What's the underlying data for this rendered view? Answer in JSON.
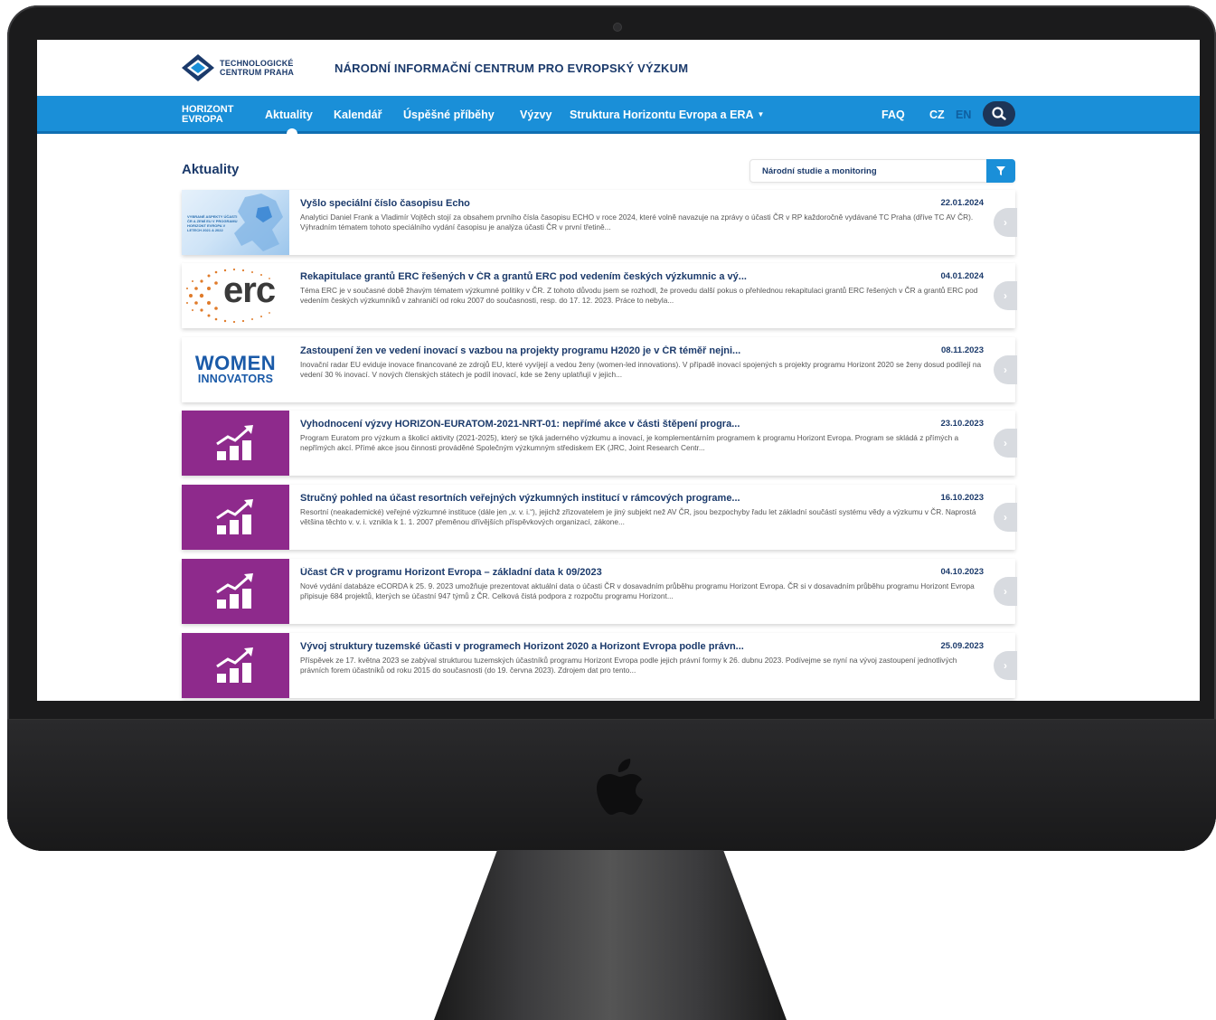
{
  "header": {
    "logo_line1": "TECHNOLOGICKÉ",
    "logo_line2": "CENTRUM PRAHA",
    "site_title": "NÁRODNÍ INFORMAČNÍ CENTRUM PRO EVROPSKÝ VÝZKUM"
  },
  "nav": {
    "brand_line1": "HORIZONT",
    "brand_line2": "EVROPA",
    "items": [
      "Aktuality",
      "Kalendář",
      "Úspěšné příběhy",
      "Výzvy",
      "Struktura Horizontu Evropa a ERA"
    ],
    "active": "Aktuality",
    "faq": "FAQ",
    "lang_cz": "CZ",
    "lang_en": "EN",
    "colors": {
      "bar": "#1a8fd8",
      "search_bg": "#1d3557"
    }
  },
  "page": {
    "heading": "Aktuality",
    "filter_value": "Národní studie a monitoring"
  },
  "news": [
    {
      "thumb": "map",
      "thumb_text": "VYBRANÉ ASPEKTY ÚČASTI ČR A ZEMÍ EU V PROGRAMU HORIZONT EVROPA V LETECH 2021 A 2022",
      "title": "Vyšlo speciální číslo časopisu Echo",
      "date": "22.01.2024",
      "text": "Analytici Daniel Frank a Vladimír Vojtěch stojí za obsahem prvního čísla časopisu ECHO v roce 2024, které volně navazuje na zprávy o účasti ČR v RP každoročně vydávané TC Praha (dříve TC AV ČR). Výhradním tématem tohoto speciálního vydání časopisu je analýza účasti ČR v první třetině..."
    },
    {
      "thumb": "erc",
      "thumb_text": "erc",
      "title": "Rekapitulace grantů ERC řešených v ČR a grantů ERC pod vedením českých výzkumnic a vý...",
      "date": "04.01.2024",
      "text": "Téma ERC je v současné době žhavým tématem výzkumné politiky v ČR. Z tohoto důvodu jsem se rozhodl, že provedu další pokus o přehlednou rekapitulaci grantů ERC řešených v ČR a grantů ERC pod vedením českých výzkumníků v zahraničí od roku 2007 do současnosti, resp. do 17. 12. 2023. Práce to nebyla..."
    },
    {
      "thumb": "women",
      "thumb_text_1": "WOMEN",
      "thumb_text_2": "INNOVATORS",
      "title": "Zastoupení žen ve vedení inovací s vazbou na projekty programu H2020 je v ČR téměř nejni...",
      "date": "08.11.2023",
      "text": "Inovační radar EU eviduje inovace financované ze zdrojů EU, které vyvíjejí a vedou ženy (women-led innovations). V případě inovací spojených s projekty programu Horizont 2020 se ženy dosud podílejí na vedení 30 % inovací. V nových členských státech je podíl inovací, kde se ženy uplatňují v jejich..."
    },
    {
      "thumb": "chart",
      "title": "Vyhodnocení výzvy HORIZON-EURATOM-2021-NRT-01: nepřímé akce v části štěpení progra...",
      "date": "23.10.2023",
      "text": "Program Euratom pro výzkum a školicí aktivity (2021-2025), který se týká jaderného výzkumu a inovací, je komplementárním programem k programu Horizont Evropa. Program se skládá z přímých a nepřímých akcí. Přímé akce jsou činnosti prováděné Společným výzkumným střediskem EK (JRC, Joint Research Centr..."
    },
    {
      "thumb": "chart",
      "title": "Stručný pohled na účast resortních veřejných výzkumných institucí v rámcových programe...",
      "date": "16.10.2023",
      "text": "Resortní (neakademické) veřejné výzkumné instituce (dále jen „v. v. i.“), jejichž zřizovatelem je jiný subjekt než AV ČR, jsou bezpochyby řadu let základní součástí systému vědy a výzkumu v ČR. Naprostá většina těchto v. v. i. vznikla k 1. 1. 2007 přeměnou dřívějších příspěvkových organizací, zákone..."
    },
    {
      "thumb": "chart",
      "title": "Účast ČR v programu Horizont Evropa – základní data k 09/2023",
      "date": "04.10.2023",
      "text": "Nové vydání databáze eCORDA k 25. 9. 2023 umožňuje prezentovat aktuální data o účasti ČR v dosavadním průběhu programu Horizont Evropa. ČR si v dosavadním průběhu programu Horizont Evropa připisuje 684 projektů, kterých se účastní 947 týmů z ČR. Celková čistá podpora z rozpočtu programu Horizont..."
    },
    {
      "thumb": "chart",
      "title": "Vývoj struktury tuzemské účasti v programech Horizont 2020 a Horizont Evropa podle právn...",
      "date": "25.09.2023",
      "text": "Příspěvek ze 17. května 2023 se zabýval strukturou tuzemských účastníků programu Horizont Evropa podle jejich právní formy k 26. dubnu 2023. Podívejme se nyní na vývoj zastoupení jednotlivých právních forem účastníků od roku 2015 do současnosti (do 19. června 2023). Zdrojem dat pro tento..."
    }
  ]
}
